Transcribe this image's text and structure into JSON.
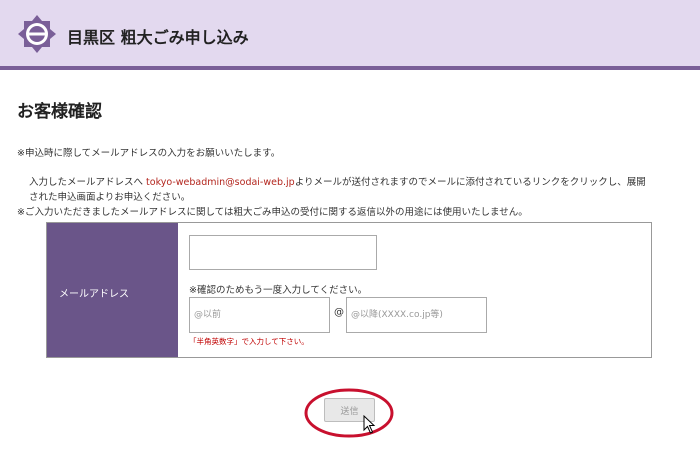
{
  "header": {
    "title": "目黒区 粗大ごみ申し込み",
    "logo_icon": "meguro-emblem-icon",
    "background": "#e3d9ef",
    "accent": "#7a5f98"
  },
  "page": {
    "title": "お客様確認"
  },
  "notes": {
    "line1": "※申込時に際してメールアドレスの入力をお願いいたします。",
    "line2_before": "入力したメールアドレスへ ",
    "line2_email": "tokyo-webadmin@sodai-web.jp",
    "line2_after": "よりメールが送付されますのでメールに添付されているリンクをクリックし、展開",
    "line3": "された申込画面よりお申込ください。",
    "line4": "※ご入力いただきましたメールアドレスに関しては粗大ごみ申込の受付に関する返信以外の用途には使用いたしません。"
  },
  "form": {
    "label": "メールアドレス",
    "label_bg": "#6a5589",
    "email_value": "",
    "confirm_text": "※確認のためもう一度入力してください。",
    "local_placeholder": "@以前",
    "at_symbol": "@",
    "domain_placeholder": "@以降(XXXX.co.jp等)",
    "hint": "「半角英数字」で入力して下さい。"
  },
  "actions": {
    "submit_label": "送信"
  },
  "annotation": {
    "ring_color": "#c8102e"
  }
}
